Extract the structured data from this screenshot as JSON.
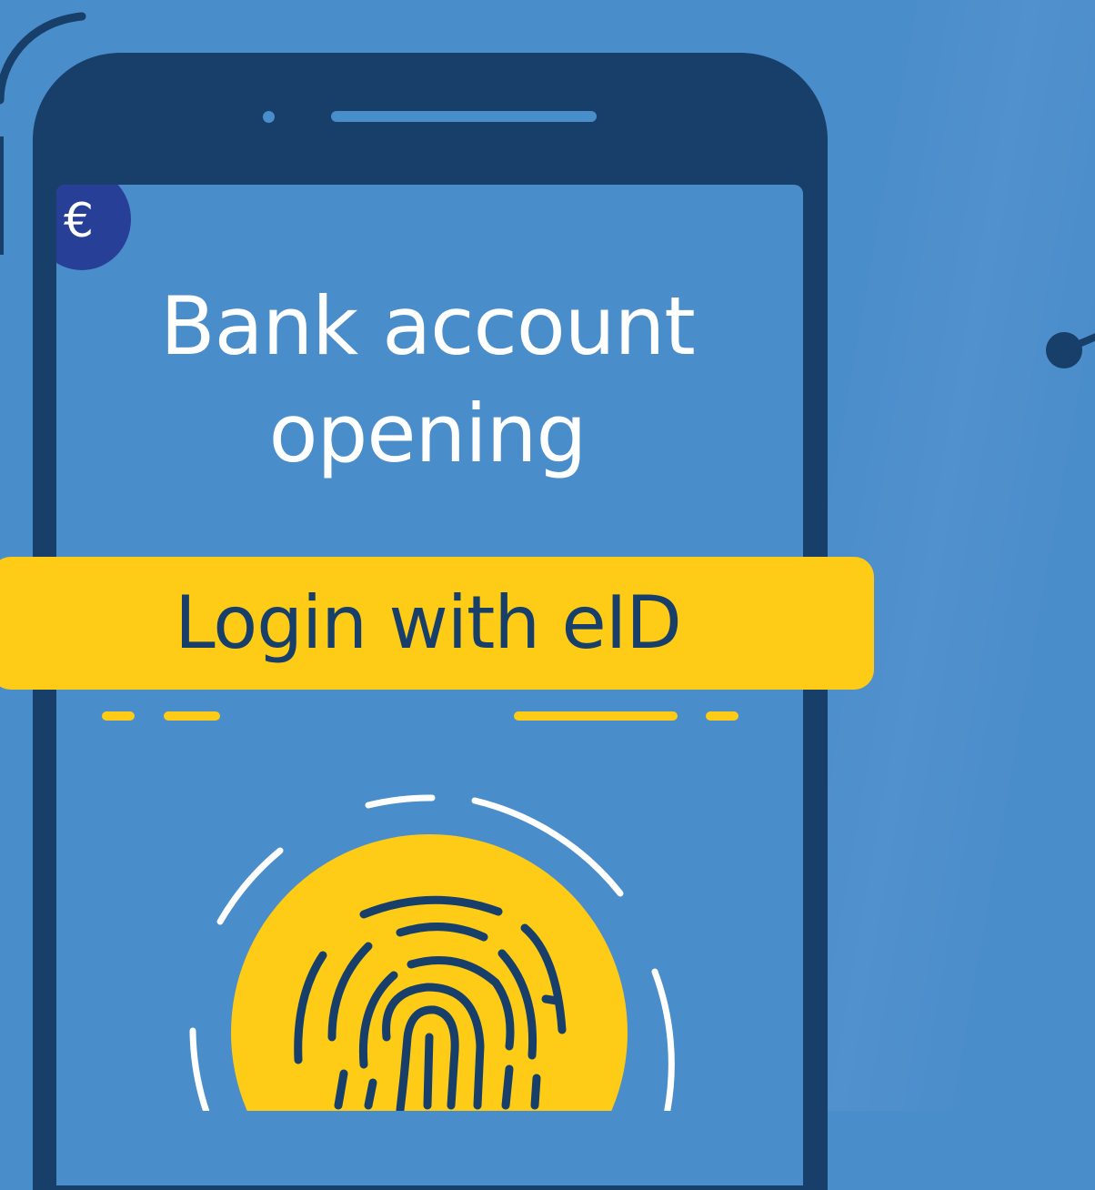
{
  "screen": {
    "title_line1": "Bank account",
    "title_line2": "opening",
    "currency_symbol": "€"
  },
  "login": {
    "label": "Login with eID"
  },
  "icons": {
    "currency": "euro-icon",
    "fingerprint": "fingerprint-icon"
  },
  "colors": {
    "background": "#4a8dcb",
    "phone_frame": "#173f69",
    "accent_yellow": "#fecb16",
    "badge_blue": "#273f97",
    "text_light": "#ffffff",
    "text_dark": "#173f69"
  }
}
